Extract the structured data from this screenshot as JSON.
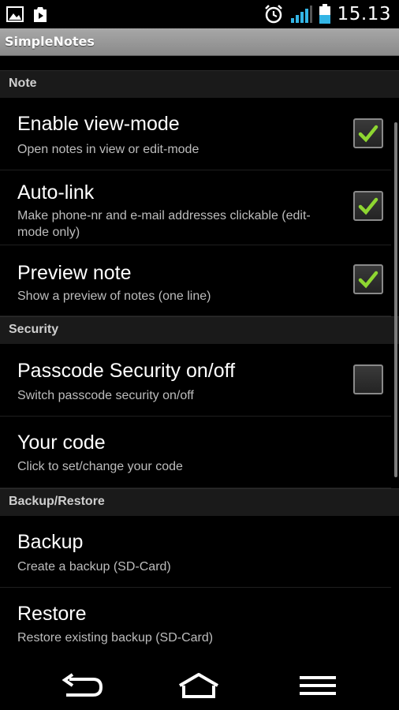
{
  "status_bar": {
    "time": "15.13",
    "icons": [
      "gallery-notification-icon",
      "play-store-notification-icon",
      "alarm-icon",
      "signal-icon",
      "battery-icon"
    ]
  },
  "app": {
    "title": "SimpleNotes"
  },
  "sections": [
    {
      "header": "Note",
      "items": [
        {
          "title": "Enable view-mode",
          "summary": "Open notes in view or edit-mode",
          "checked": true
        },
        {
          "title": "Auto-link",
          "summary": "Make phone-nr and e-mail addresses clickable (edit-mode only)",
          "checked": true
        },
        {
          "title": "Preview note",
          "summary": "Show a preview of notes (one line)",
          "checked": true
        }
      ]
    },
    {
      "header": "Security",
      "items": [
        {
          "title": "Passcode Security on/off",
          "summary": "Switch passcode security on/off",
          "checked": false
        },
        {
          "title": "Your code",
          "summary": "Click to set/change your code"
        }
      ]
    },
    {
      "header": "Backup/Restore",
      "items": [
        {
          "title": "Backup",
          "summary": "Create a backup (SD-Card)"
        },
        {
          "title": "Restore",
          "summary": "Restore existing backup (SD-Card)"
        }
      ]
    }
  ],
  "colors": {
    "accent_green": "#8ed631",
    "signal": "#33b5e5",
    "section_bg": "#1a1a1a"
  },
  "nav_bar": {
    "icons": [
      "back-icon",
      "home-icon",
      "menu-icon"
    ]
  }
}
